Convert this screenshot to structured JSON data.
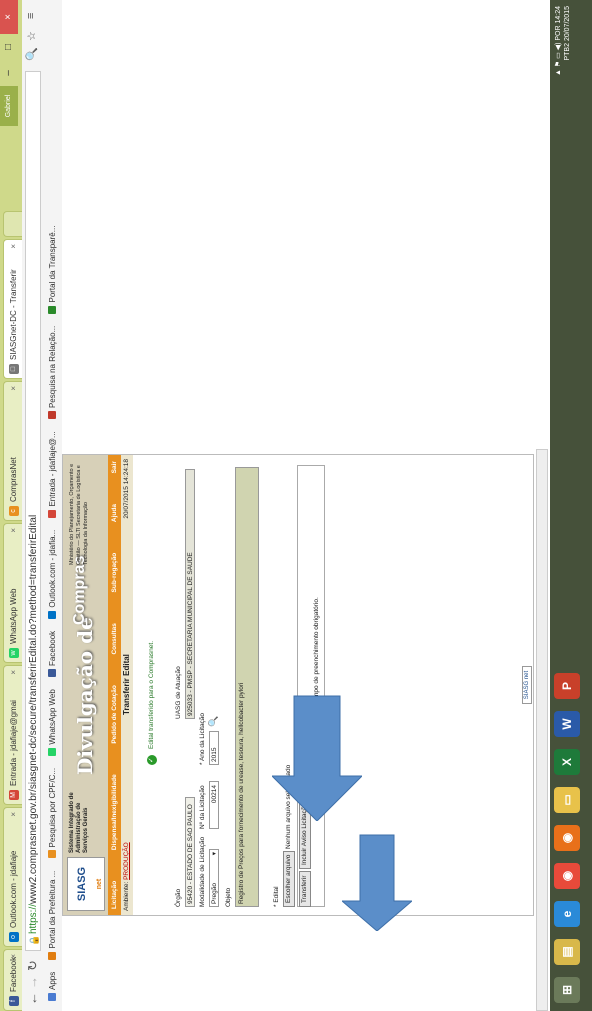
{
  "browser": {
    "tabs": [
      {
        "label": "Facebook",
        "icon_color": "#3b5998",
        "icon_text": "f"
      },
      {
        "label": "Outlook.com - jdafiaje",
        "icon_color": "#0072c6",
        "icon_text": "o"
      },
      {
        "label": "Entrada - jdafiaje@gmai",
        "icon_color": "#d44638",
        "icon_text": "M"
      },
      {
        "label": "WhatsApp Web",
        "icon_color": "#25d366",
        "icon_text": "w"
      },
      {
        "label": "ComprasNet",
        "icon_color": "#e8901f",
        "icon_text": "c"
      },
      {
        "label": "SIASGnet-DC - Transferir",
        "icon_color": "#777777",
        "icon_text": "□"
      }
    ],
    "user_chip": "Gabriel",
    "url_https": "https://",
    "url_rest": "www2.comprasnet.gov.br/siasgnet-dc/secure/transferirEdital.do?method=transferirEdital",
    "bookmarks": [
      {
        "label": "Apps",
        "color": "#4a7bd1"
      },
      {
        "label": "Portal da Prefeitura ...",
        "color": "#e07d10"
      },
      {
        "label": "Pesquisa por CPF/C...",
        "color": "#e8901f"
      },
      {
        "label": "WhatsApp Web",
        "color": "#25d366"
      },
      {
        "label": "Facebook",
        "color": "#3b5998"
      },
      {
        "label": "Outlook.com - jdafia...",
        "color": "#0072c6"
      },
      {
        "label": "Entrada - jdafiaje@...",
        "color": "#d44638"
      },
      {
        "label": "Pesquisa na Relação...",
        "color": "#c0392b"
      },
      {
        "label": "Portal da Transparê...",
        "color": "#2a8a2a"
      }
    ]
  },
  "siasg": {
    "logo": "SIASG",
    "logo_sub": "net",
    "sistema": "Sistema Integrado de Administração de Serviços Gerais",
    "divulgacao": "Divulgação de",
    "compras": "Compras",
    "ministerio": "Ministério do Planejamento, Orçamento e Gestão — SLTI Secretaria de Logística e Tecnologia da Informação",
    "menu": [
      "Licitação",
      "Dispensa/Inexigibilidade",
      "Pedido de Cotação",
      "Consultas",
      "Sub-rogação",
      "Ajuda",
      "Sair"
    ],
    "ambiente_label": "Ambiente:",
    "ambiente_value": "PRODUÇÃO",
    "page_title": "Transferir Edital",
    "datetime": "20/07/2015 14:24:18",
    "success_msg": "Edital transferido para o Comprasnet.",
    "orgao_label": "Órgão",
    "orgao_value": "95420 - ESTADO DE SAO PAULO",
    "uasg_label": "UASG de Atuação",
    "uasg_value": "925033 - PMSP - SECRETARIA MUNICIPAL DE SAUDE",
    "modalidade_label": "Modalidade de Licitação",
    "modalidade_value": "Pregão",
    "numero_label": "Nº da Licitação",
    "numero_value": "00214",
    "ano_label": "* Ano da Licitação",
    "ano_value": "2015",
    "objeto_label": "Objeto",
    "objeto_value": "Registro de Preços para fornecimento de urease, tesoura, hellcobacter pylori",
    "edital_label": "* Edital",
    "choose_file": "Escolher arquivo",
    "no_file": "Nenhum arquivo selecionado",
    "transferir": "Transferir",
    "incluir_aviso": "Incluir Aviso Licitação",
    "required_note": "(*) Campo de preenchimento obrigatório.",
    "footer_logo": "SIASG net"
  },
  "taskbar": {
    "apps": [
      {
        "name": "start",
        "color": "#6b7a5a",
        "text": "⊞"
      },
      {
        "name": "explorer",
        "color": "#d8b84a",
        "text": "▤"
      },
      {
        "name": "ie",
        "color": "#2a8ad8",
        "text": "e"
      },
      {
        "name": "chrome",
        "color": "#e84a3a",
        "text": "◉"
      },
      {
        "name": "firefox",
        "color": "#e8701a",
        "text": "◉"
      },
      {
        "name": "folder",
        "color": "#e8c24a",
        "text": "▭"
      },
      {
        "name": "excel",
        "color": "#1e7a3a",
        "text": "X"
      },
      {
        "name": "word",
        "color": "#2a5aa8",
        "text": "W"
      },
      {
        "name": "powerpoint",
        "color": "#c8402a",
        "text": "P"
      }
    ],
    "lang": "POR",
    "lang2": "PTB2",
    "time": "14:24",
    "date": "20/07/2015"
  }
}
